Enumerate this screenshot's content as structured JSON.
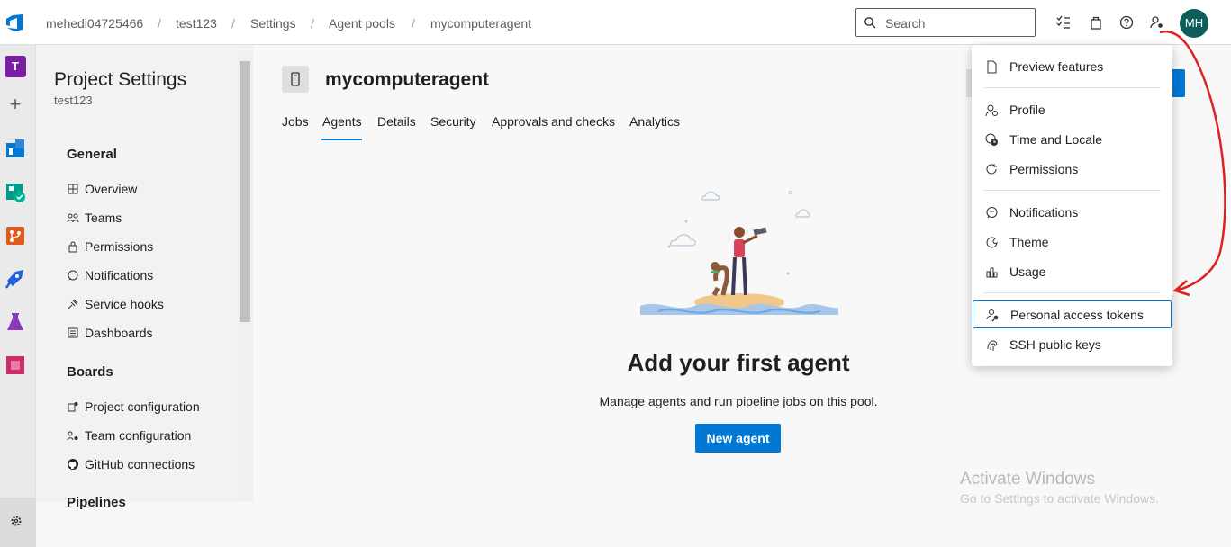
{
  "breadcrumb": [
    "mehedi04725466",
    "test123",
    "Settings",
    "Agent pools",
    "mycomputeragent"
  ],
  "breadcrumb_separator": "/",
  "search": {
    "placeholder": "Search"
  },
  "avatar": {
    "initials": "MH"
  },
  "rail": {
    "project_initial": "T",
    "project_color": "#7b1fa2"
  },
  "nav": {
    "title": "Project Settings",
    "subtitle": "test123",
    "groups": [
      {
        "label": "General",
        "items": [
          "Overview",
          "Teams",
          "Permissions",
          "Notifications",
          "Service hooks",
          "Dashboards"
        ]
      },
      {
        "label": "Boards",
        "items": [
          "Project configuration",
          "Team configuration",
          "GitHub connections"
        ]
      },
      {
        "label": "Pipelines",
        "items": []
      }
    ]
  },
  "main": {
    "pool_title": "mycomputeragent",
    "tabs": [
      "Jobs",
      "Agents",
      "Details",
      "Security",
      "Approvals and checks",
      "Analytics"
    ],
    "active_tab": "Agents",
    "empty_title": "Add your first agent",
    "empty_desc": "Manage agents and run pipeline jobs on this pool.",
    "new_agent_label": "New agent"
  },
  "user_menu": {
    "items": [
      {
        "label": "Preview features",
        "icon": "document-icon"
      },
      {
        "label": "Profile",
        "icon": "profile-icon"
      },
      {
        "label": "Time and Locale",
        "icon": "clock-globe-icon"
      },
      {
        "label": "Permissions",
        "icon": "refresh-icon"
      },
      {
        "label": "Notifications",
        "icon": "chat-icon"
      },
      {
        "label": "Theme",
        "icon": "theme-icon"
      },
      {
        "label": "Usage",
        "icon": "bar-chart-icon"
      },
      {
        "label": "Personal access tokens",
        "icon": "key-person-icon",
        "selected": true
      },
      {
        "label": "SSH public keys",
        "icon": "fingerprint-key-icon"
      }
    ]
  },
  "watermark": {
    "line1": "Activate Windows",
    "line2": "Go to Settings to activate Windows."
  },
  "colors": {
    "accent": "#0078d4",
    "annotation": "#e02020",
    "avatar": "#0b5e5a"
  }
}
